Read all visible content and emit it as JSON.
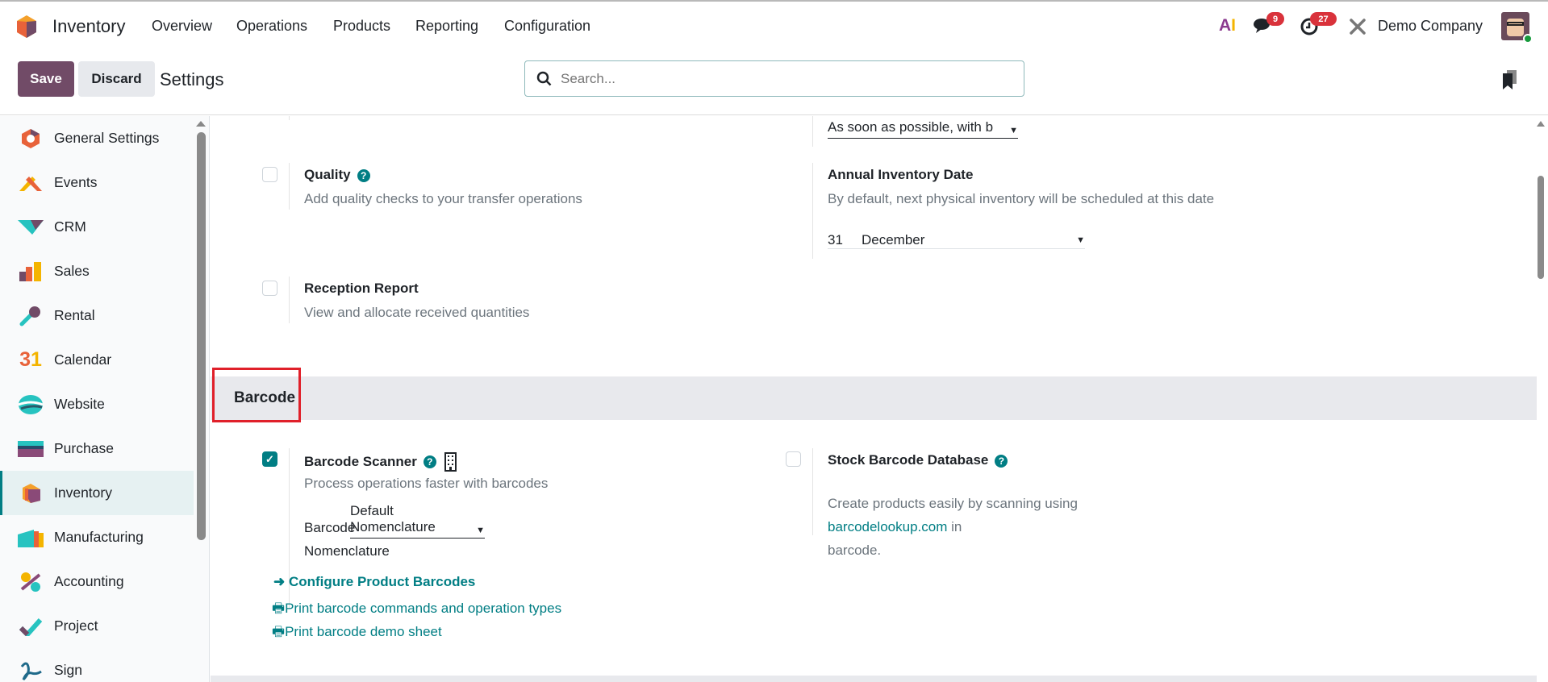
{
  "topbar": {
    "app_name": "Inventory",
    "menu": [
      "Overview",
      "Operations",
      "Products",
      "Reporting",
      "Configuration"
    ],
    "messages_count": "9",
    "activities_count": "27",
    "company": "Demo Company",
    "ai_label": "AI"
  },
  "control": {
    "save": "Save",
    "discard": "Discard",
    "title": "Settings",
    "search_placeholder": "Search..."
  },
  "sidebar": {
    "items": [
      {
        "label": "General Settings"
      },
      {
        "label": "Events"
      },
      {
        "label": "CRM"
      },
      {
        "label": "Sales"
      },
      {
        "label": "Rental"
      },
      {
        "label": "Calendar"
      },
      {
        "label": "Website"
      },
      {
        "label": "Purchase"
      },
      {
        "label": "Inventory"
      },
      {
        "label": "Manufacturing"
      },
      {
        "label": "Accounting"
      },
      {
        "label": "Project"
      },
      {
        "label": "Sign"
      }
    ],
    "active": "Inventory"
  },
  "settings": {
    "shipping_policy_value": "As soon as possible, with b",
    "quality": {
      "title": "Quality",
      "desc": "Add quality checks to your transfer operations",
      "checked": false
    },
    "annual": {
      "title": "Annual Inventory Date",
      "desc": "By default, next physical inventory will be scheduled at this date",
      "day": "31",
      "month": "December"
    },
    "reception": {
      "title": "Reception Report",
      "desc": "View and allocate received quantities",
      "checked": false
    },
    "section": "Barcode",
    "scanner": {
      "title": "Barcode Scanner",
      "desc": "Process operations faster with barcodes",
      "checked": true,
      "nom_label_1": "Barcode",
      "nom_label_2": "Nomenclature",
      "nom_value": "Default Nomenclature",
      "configure": "Configure Product Barcodes",
      "print1": "Print barcode commands and operation types",
      "print2": "Print barcode demo sheet"
    },
    "stock_db": {
      "title": "Stock Barcode Database",
      "desc_pre": "Create products easily by scanning using ",
      "link": "barcodelookup.com",
      "desc_post": " in",
      "desc_line2": "barcode.",
      "checked": false
    }
  },
  "colors": {
    "primary": "#714b67",
    "accent": "#017e84",
    "highlight": "#e0202a"
  }
}
